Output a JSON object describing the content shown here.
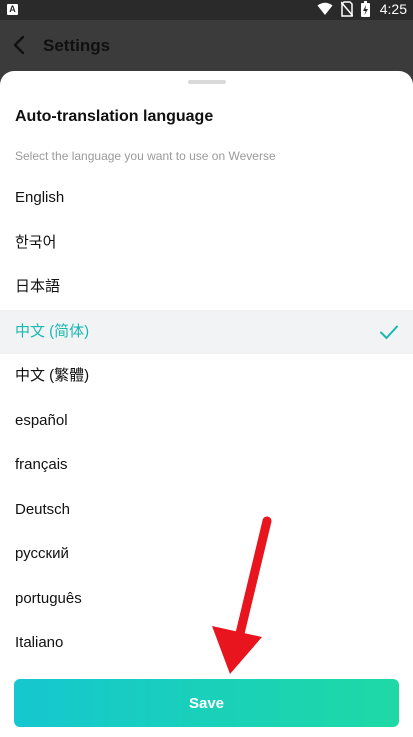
{
  "status_bar": {
    "app_badge": "A",
    "icons": [
      "wifi-icon",
      "no-sim-icon",
      "battery-charging-icon"
    ],
    "time": "4:25"
  },
  "appbar": {
    "back_icon": "chevron-left-icon",
    "title": "Settings"
  },
  "sheet": {
    "title": "Auto-translation language",
    "subtitle": "Select the language you want to use on Weverse",
    "languages": [
      {
        "label": "English",
        "selected": false
      },
      {
        "label": "한국어",
        "selected": false
      },
      {
        "label": "日本語",
        "selected": false
      },
      {
        "label": "中文 (简体)",
        "selected": true
      },
      {
        "label": "中文 (繁體)",
        "selected": false
      },
      {
        "label": "español",
        "selected": false
      },
      {
        "label": "français",
        "selected": false
      },
      {
        "label": "Deutsch",
        "selected": false
      },
      {
        "label": "русский",
        "selected": false
      },
      {
        "label": "português",
        "selected": false
      },
      {
        "label": "Italiano",
        "selected": false
      }
    ],
    "selected_icon": "checkmark-icon",
    "save_label": "Save"
  },
  "colors": {
    "accent": "#1ab8b0",
    "save_gradient_start": "#15c7cf",
    "save_gradient_end": "#1ed9a5",
    "annotation_arrow": "#e8141e"
  }
}
